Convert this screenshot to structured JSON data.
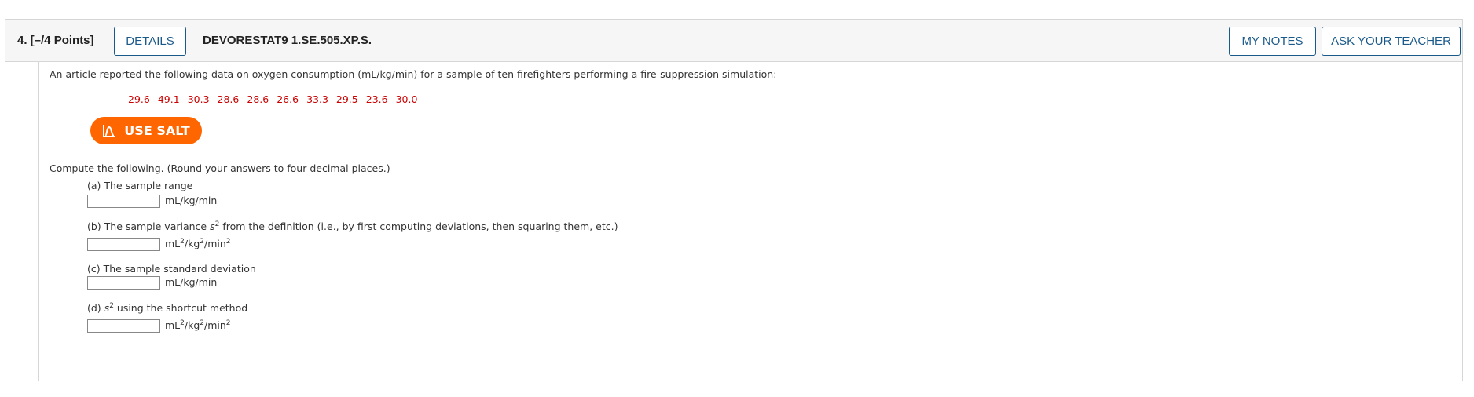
{
  "header": {
    "question_label": "4.  [–/4 Points]",
    "details_label": "DETAILS",
    "code": "DEVORESTAT9 1.SE.505.XP.S.",
    "my_notes_label": "MY NOTES",
    "ask_teacher_label": "ASK YOUR TEACHER"
  },
  "question": {
    "intro": "An article reported the following data on oxygen consumption (mL/kg/min) for a sample of ten firefighters performing a fire-suppression simulation:",
    "data": [
      "29.6",
      "49.1",
      "30.3",
      "28.6",
      "28.6",
      "26.6",
      "33.3",
      "29.5",
      "23.6",
      "30.0"
    ],
    "salt_label": "USE SALT",
    "compute": "Compute the following. (Round your answers to four decimal places.)",
    "parts": {
      "a": {
        "prefix": "(a) The sample range",
        "unit": "mL/kg/min",
        "value": ""
      },
      "b": {
        "prefix": "(b) The sample variance ",
        "var": "s",
        "exp": "2",
        "suffix": " from the definition (i.e., by first computing deviations, then squaring them, etc.)",
        "unit_base1": "mL",
        "unit_exp1": "2",
        "unit_base2": "/kg",
        "unit_exp2": "2",
        "unit_base3": "/min",
        "unit_exp3": "2",
        "value": ""
      },
      "c": {
        "prefix": "(c) The sample standard deviation",
        "unit": "mL/kg/min",
        "value": ""
      },
      "d": {
        "prefix": "(d) ",
        "var": "s",
        "exp": "2",
        "suffix": " using the shortcut method",
        "unit_base1": "mL",
        "unit_exp1": "2",
        "unit_base2": "/kg",
        "unit_exp2": "2",
        "unit_base3": "/min",
        "unit_exp3": "2",
        "value": ""
      }
    }
  },
  "colors": {
    "accent": "#ff6600",
    "link_blue": "#1a5a8a",
    "data_red": "#cc0000"
  }
}
